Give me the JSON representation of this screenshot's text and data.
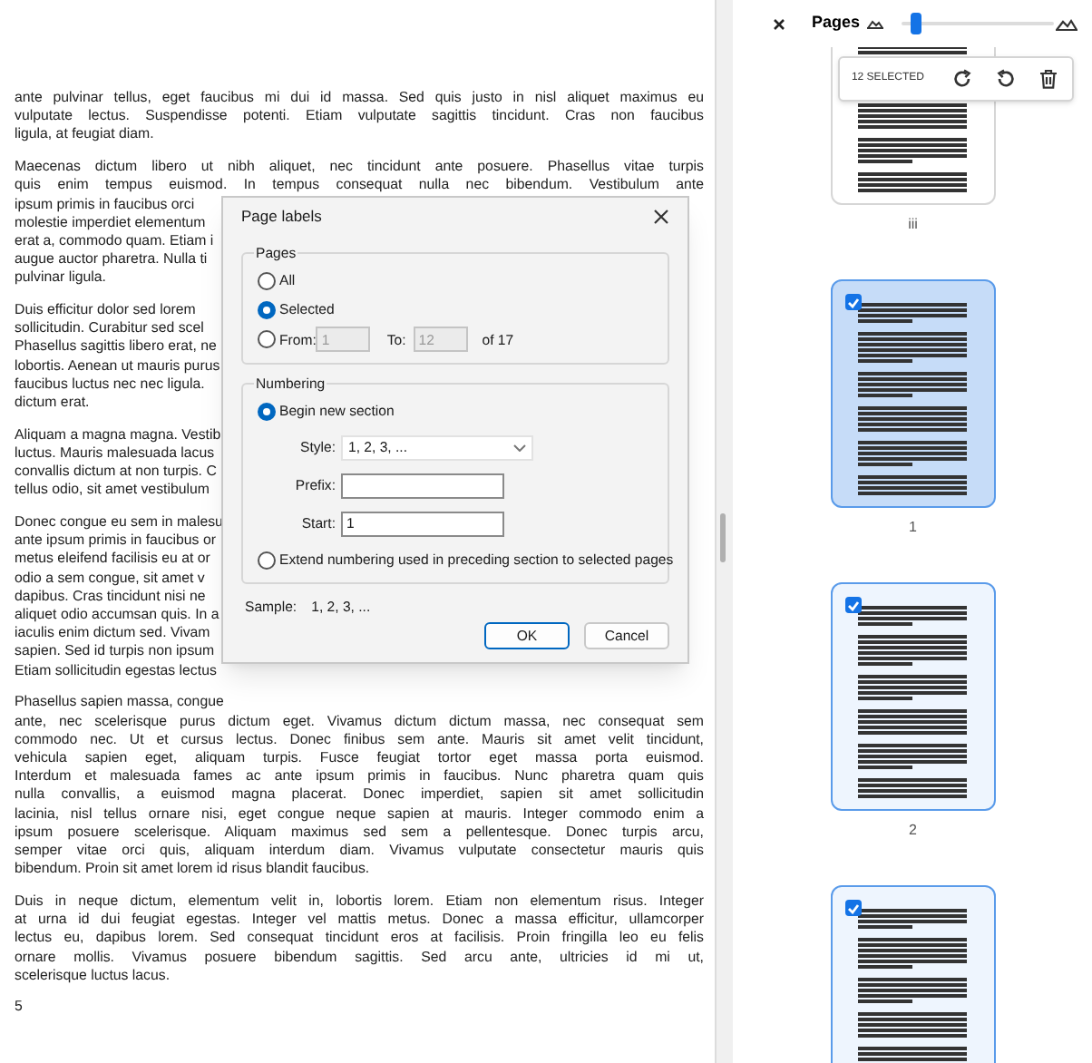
{
  "document": {
    "paragraphs": [
      [
        "ante pulvinar tellus, eget faucibus mi dui id massa. Sed quis justo in nisl aliquet maximus eu",
        "vulputate lectus. Suspendisse potenti. Etiam vulputate sagittis tincidunt. Cras non faucibus",
        "ligula, at feugiat diam."
      ],
      [
        "Maecenas dictum libero ut nibh aliquet, nec tincidunt ante posuere. Phasellus vitae turpis",
        "quis enim tempus euismod. In tempus consequat nulla nec bibendum. Vestibulum ante",
        "ipsum primis in faucibus orci",
        "molestie imperdiet elementum",
        "erat a, commodo quam. Etiam i",
        "augue auctor pharetra. Nulla ti",
        "pulvinar ligula."
      ],
      [
        "Duis efficitur dolor sed lorem",
        "sollicitudin. Curabitur sed scel",
        "Phasellus sagittis libero erat, ne",
        "lobortis. Aenean ut mauris purus",
        "faucibus luctus nec nec ligula.",
        "dictum erat."
      ],
      [
        "Aliquam a magna magna. Vestib",
        "luctus. Mauris malesuada lacus",
        "convallis dictum at non turpis. C",
        "tellus odio, sit amet vestibulum"
      ],
      [
        "Donec congue eu sem in malesu",
        "ante ipsum primis in faucibus or",
        "metus eleifend facilisis eu at or",
        "odio a sem congue, sit amet v",
        "dapibus. Cras tincidunt nisi ne",
        "aliquet odio accumsan quis. In a",
        "iaculis enim dictum sed. Vivam",
        "sapien. Sed id turpis non ipsum",
        "Etiam sollicitudin egestas lectus"
      ],
      [
        "Phasellus sapien massa, congue",
        "ante, nec scelerisque purus dictum eget. Vivamus dictum dictum massa, nec consequat sem",
        "commodo nec. Ut et cursus lectus. Donec finibus sem ante. Mauris sit amet velit tincidunt,",
        "vehicula sapien eget, aliquam turpis. Fusce feugiat tortor eget massa porta euismod.",
        "Interdum et malesuada fames ac ante ipsum primis in faucibus. Nunc pharetra quam quis",
        "nulla convallis, a euismod magna placerat. Donec imperdiet, sapien sit amet sollicitudin",
        "lacinia, nisl tellus ornare nisi, eget congue neque sapien at mauris. Integer commodo enim a",
        "ipsum posuere scelerisque. Aliquam maximus sed sem a pellentesque. Donec turpis arcu,",
        "semper vitae orci quis, aliquam interdum diam. Vivamus vulputate consectetur mauris quis",
        "bibendum. Proin sit amet lorem id risus blandit faucibus."
      ],
      [
        "Duis in neque dictum, elementum velit in, lobortis lorem. Etiam non elementum risus. Integer",
        "at urna id dui feugiat egestas. Integer vel mattis metus. Donec a massa efficitur, ullamcorper",
        "lectus eu, dapibus lorem. Sed consequat tincidunt eros at facilisis. Proin fringilla leo eu felis",
        "ornare mollis. Vivamus posuere bibendum sagittis. Sed arcu ante, ultricies id mi ut,",
        "scelerisque luctus lacus."
      ]
    ],
    "page_number": "5"
  },
  "dialog": {
    "title": "Page labels",
    "pages_group": {
      "legend": "Pages",
      "options": [
        {
          "label": "All",
          "selected": false
        },
        {
          "label": "Selected",
          "selected": true
        },
        {
          "label": "From:",
          "selected": false
        }
      ],
      "from": {
        "value": "1",
        "disabled": true
      },
      "to_label": "To:",
      "to": {
        "value": "12",
        "disabled": true
      },
      "of_text": "of 17"
    },
    "numbering_group": {
      "legend": "Numbering",
      "options": [
        {
          "label": "Begin new section",
          "selected": true
        },
        {
          "label": "Extend numbering used in preceding section to selected pages",
          "selected": false
        }
      ],
      "style": {
        "label": "Style:",
        "value": "1, 2, 3, ..."
      },
      "prefix": {
        "label": "Prefix:"
      },
      "start": {
        "label": "Start:",
        "value": "1"
      }
    },
    "sample_label": "Sample:",
    "sample_value": "1, 2, 3, ...",
    "buttons": [
      {
        "label": "OK",
        "kind": "primary"
      },
      {
        "label": "Cancel",
        "kind": "secondary"
      }
    ]
  },
  "pages_panel": {
    "title": "Pages",
    "zoom": {
      "level": 0.08
    },
    "selection_bar": {
      "count": "12 SELECTED"
    },
    "thumbnails": [
      {
        "label": "iii",
        "selected": false,
        "current": false
      },
      {
        "label": "1",
        "selected": true,
        "current": true
      },
      {
        "label": "2",
        "selected": true,
        "current": false
      },
      {
        "selected": true,
        "current": false
      }
    ]
  }
}
